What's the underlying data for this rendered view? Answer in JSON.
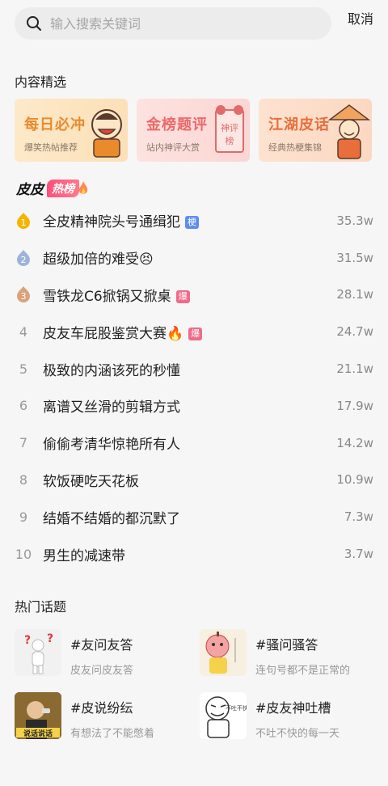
{
  "search": {
    "placeholder": "输入搜索关键词",
    "cancel_label": "取消"
  },
  "featured": {
    "title": "内容精选",
    "cards": [
      {
        "title": "每日必冲",
        "subtitle": "爆笑热帖推荐"
      },
      {
        "title": "金榜题评",
        "subtitle": "站内神评大赏"
      },
      {
        "title": "江湖皮话",
        "subtitle": "经典热梗集锦"
      }
    ]
  },
  "hot_list": {
    "brand": "皮皮",
    "badge": "热榜",
    "items": [
      {
        "rank": "1",
        "title": "全皮精神院头号通缉犯",
        "tag": "梗",
        "count": "35.3w"
      },
      {
        "rank": "2",
        "title": "超级加倍的难受😣",
        "tag": "",
        "count": "31.5w"
      },
      {
        "rank": "3",
        "title": "雪铁龙C6掀锅又掀桌",
        "tag": "爆",
        "count": "28.1w"
      },
      {
        "rank": "4",
        "title": "皮友车屁股鉴赏大赛🔥",
        "tag": "爆",
        "count": "24.7w"
      },
      {
        "rank": "5",
        "title": "极致的内涵该死的秒懂",
        "tag": "",
        "count": "21.1w"
      },
      {
        "rank": "6",
        "title": "离谱又丝滑的剪辑方式",
        "tag": "",
        "count": "17.9w"
      },
      {
        "rank": "7",
        "title": "偷偷考清华惊艳所有人",
        "tag": "",
        "count": "14.2w"
      },
      {
        "rank": "8",
        "title": "软饭硬吃天花板",
        "tag": "",
        "count": "10.9w"
      },
      {
        "rank": "9",
        "title": "结婚不结婚的都沉默了",
        "tag": "",
        "count": "7.3w"
      },
      {
        "rank": "10",
        "title": "男生的减速带",
        "tag": "",
        "count": "3.7w"
      }
    ]
  },
  "topics": {
    "title": "热门话题",
    "items": [
      {
        "name": "#友问友答",
        "desc": "皮友问皮友答"
      },
      {
        "name": "#骚问骚答",
        "desc": "连句号都不是正常的"
      },
      {
        "name": "#皮说纷纭",
        "desc": "有想法了不能憋着",
        "thumb_caption": "说话说话"
      },
      {
        "name": "#皮友神吐槽",
        "desc": "不吐不快的每一天",
        "thumb_caption": "不吐不快"
      }
    ]
  },
  "colors": {
    "medal_gold": "#f4b400",
    "medal_silver": "#9fb3d8",
    "medal_bronze": "#d9a27a",
    "tag_geng": "#5a8ef0",
    "tag_bao": "#f06a8a"
  }
}
